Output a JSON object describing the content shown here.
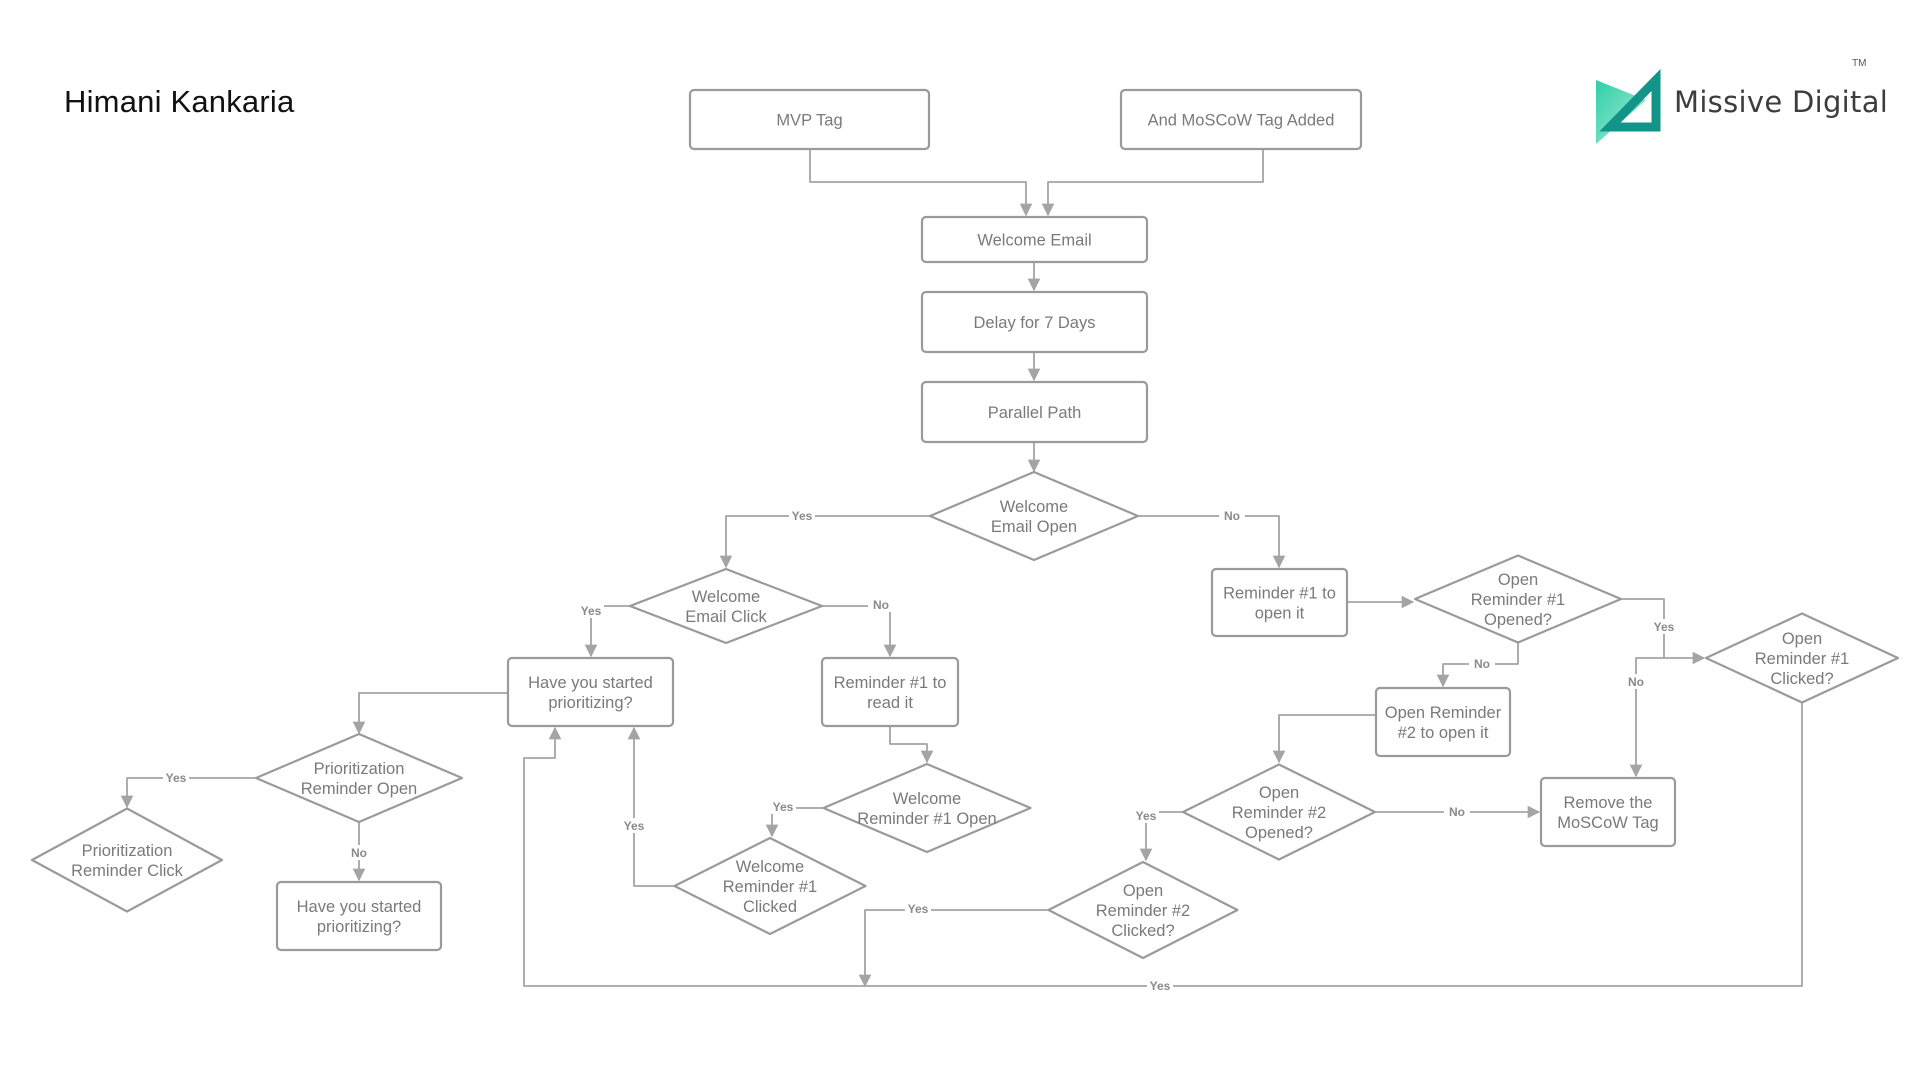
{
  "header": {
    "author": "Himani Kankaria",
    "brand": "Missive Digital",
    "trademark": "TM"
  },
  "colors": {
    "line": "#a4a4a4",
    "node_border": "#9a9a9a",
    "node_text": "#7a7a7a",
    "logo_light": "#3fd1b0",
    "logo_dark": "#129488"
  },
  "flowchart": {
    "nodes": [
      {
        "id": "mvp_tag",
        "type": "process",
        "lines": [
          "MVP Tag"
        ]
      },
      {
        "id": "moscow_tag",
        "type": "process",
        "lines": [
          "And MoSCoW Tag Added"
        ]
      },
      {
        "id": "welcome_email",
        "type": "process",
        "lines": [
          "Welcome Email"
        ]
      },
      {
        "id": "delay",
        "type": "process",
        "lines": [
          "Delay for 7 Days"
        ]
      },
      {
        "id": "parallel",
        "type": "process",
        "lines": [
          "Parallel Path"
        ]
      },
      {
        "id": "welcome_open",
        "type": "decision",
        "lines": [
          "Welcome",
          "Email Open"
        ]
      },
      {
        "id": "welcome_click",
        "type": "decision",
        "lines": [
          "Welcome",
          "Email Click"
        ]
      },
      {
        "id": "started_mid",
        "type": "process",
        "lines": [
          "Have you started",
          "prioritizing?"
        ]
      },
      {
        "id": "rem1_read",
        "type": "process",
        "lines": [
          "Reminder #1 to",
          "read it"
        ]
      },
      {
        "id": "prio_open",
        "type": "decision",
        "lines": [
          "Prioritization",
          "Reminder Open"
        ]
      },
      {
        "id": "prio_click",
        "type": "decision",
        "lines": [
          "Prioritization",
          "Reminder Click"
        ]
      },
      {
        "id": "started_bottom",
        "type": "process",
        "lines": [
          "Have you started",
          "prioritizing?"
        ]
      },
      {
        "id": "wrem1_open",
        "type": "decision",
        "lines": [
          "Welcome",
          "Reminder #1 Open"
        ]
      },
      {
        "id": "wrem1_clicked",
        "type": "decision",
        "lines": [
          "Welcome",
          "Reminder #1",
          "Clicked"
        ]
      },
      {
        "id": "rem1_open_it",
        "type": "process",
        "lines": [
          "Reminder #1 to",
          "open it"
        ]
      },
      {
        "id": "orem1_opened",
        "type": "decision",
        "lines": [
          "Open",
          "Reminder #1",
          "Opened?"
        ]
      },
      {
        "id": "orem1_clicked",
        "type": "decision",
        "lines": [
          "Open",
          "Reminder #1",
          "Clicked?"
        ]
      },
      {
        "id": "orem2_open_it",
        "type": "process",
        "lines": [
          "Open Reminder",
          "#2 to open it"
        ]
      },
      {
        "id": "orem2_opened",
        "type": "decision",
        "lines": [
          "Open",
          "Reminder #2",
          "Opened?"
        ]
      },
      {
        "id": "remove_moscow",
        "type": "process",
        "lines": [
          "Remove the",
          "MoSCoW Tag"
        ]
      },
      {
        "id": "orem2_clicked",
        "type": "decision",
        "lines": [
          "Open",
          "Reminder #2",
          "Clicked?"
        ]
      }
    ],
    "edges": [
      {
        "from": "mvp_tag",
        "to": "welcome_email",
        "label": ""
      },
      {
        "from": "moscow_tag",
        "to": "welcome_email",
        "label": ""
      },
      {
        "from": "welcome_email",
        "to": "delay",
        "label": ""
      },
      {
        "from": "delay",
        "to": "parallel",
        "label": ""
      },
      {
        "from": "parallel",
        "to": "welcome_open",
        "label": ""
      },
      {
        "from": "welcome_open",
        "to": "welcome_click",
        "label": "Yes"
      },
      {
        "from": "welcome_open",
        "to": "rem1_open_it",
        "label": "No"
      },
      {
        "from": "welcome_click",
        "to": "started_mid",
        "label": "Yes"
      },
      {
        "from": "welcome_click",
        "to": "rem1_read",
        "label": "No"
      },
      {
        "from": "started_mid",
        "to": "prio_open",
        "label": ""
      },
      {
        "from": "prio_open",
        "to": "prio_click",
        "label": "Yes"
      },
      {
        "from": "prio_open",
        "to": "started_bottom",
        "label": "No"
      },
      {
        "from": "rem1_read",
        "to": "wrem1_open",
        "label": ""
      },
      {
        "from": "wrem1_open",
        "to": "wrem1_clicked",
        "label": "Yes"
      },
      {
        "from": "wrem1_clicked",
        "to": "started_mid",
        "label": "Yes"
      },
      {
        "from": "rem1_open_it",
        "to": "orem1_opened",
        "label": ""
      },
      {
        "from": "orem1_opened",
        "to": "orem1_clicked",
        "label": "Yes"
      },
      {
        "from": "orem1_opened",
        "to": "orem2_open_it",
        "label": "No"
      },
      {
        "from": "orem1_clicked",
        "to": "remove_moscow",
        "label": "No"
      },
      {
        "from": "orem1_clicked",
        "to": "started_mid",
        "label": "Yes"
      },
      {
        "from": "orem2_open_it",
        "to": "orem2_opened",
        "label": ""
      },
      {
        "from": "orem2_opened",
        "to": "orem2_clicked",
        "label": "Yes"
      },
      {
        "from": "orem2_opened",
        "to": "remove_moscow",
        "label": "No"
      },
      {
        "from": "orem2_clicked",
        "to": "started_mid",
        "label": "Yes"
      }
    ]
  }
}
